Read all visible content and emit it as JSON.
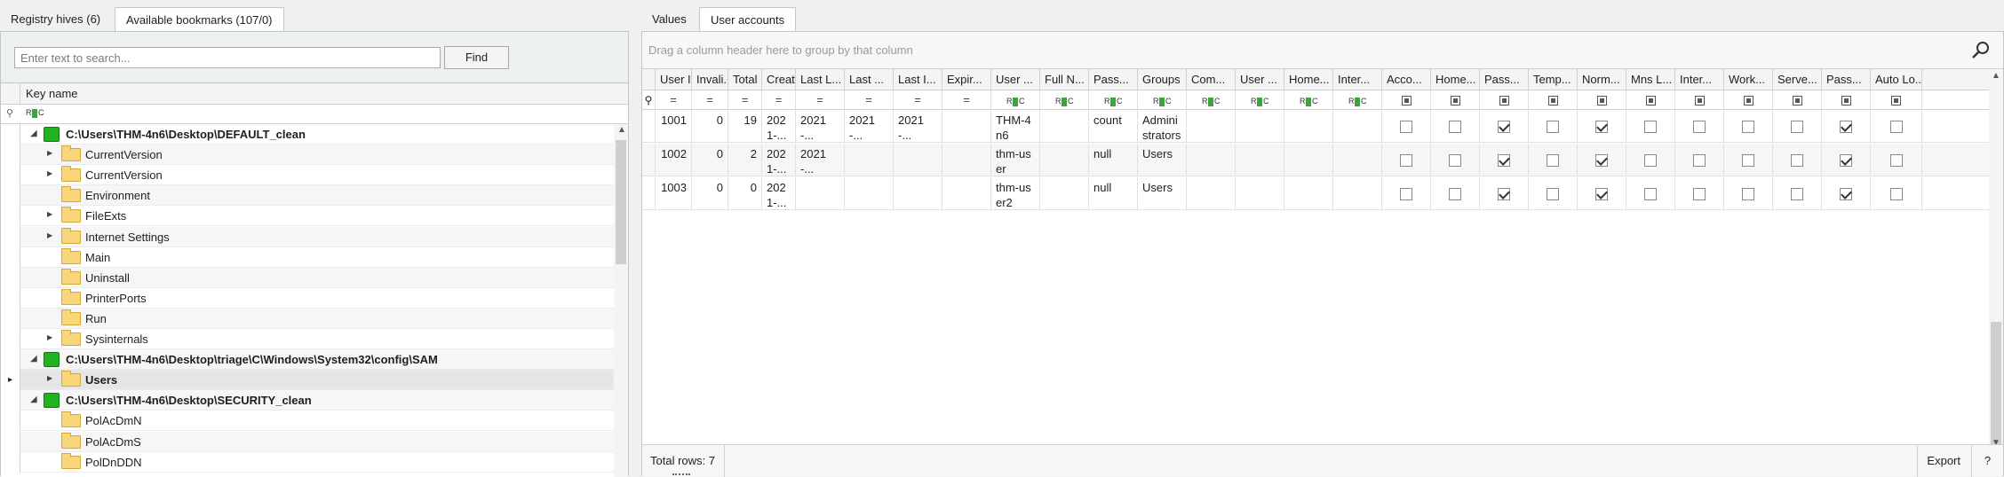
{
  "left": {
    "tabs": [
      "Registry hives (6)",
      "Available bookmarks (107/0)"
    ],
    "search_placeholder": "Enter text to search...",
    "find_label": "Find",
    "column_header": "Key name",
    "tree": [
      {
        "label": "C:\\Users\\THM-4n6\\Desktop\\DEFAULT_clean",
        "kind": "hive",
        "level": 0,
        "expander": "◢"
      },
      {
        "label": "CurrentVersion",
        "kind": "folder",
        "level": 1,
        "expander": "▶"
      },
      {
        "label": "CurrentVersion",
        "kind": "folder",
        "level": 1,
        "expander": "▶"
      },
      {
        "label": "Environment",
        "kind": "folder",
        "level": 1,
        "expander": ""
      },
      {
        "label": "FileExts",
        "kind": "folder",
        "level": 1,
        "expander": "▶"
      },
      {
        "label": "Internet Settings",
        "kind": "folder",
        "level": 1,
        "expander": "▶"
      },
      {
        "label": "Main",
        "kind": "folder",
        "level": 1,
        "expander": ""
      },
      {
        "label": "Uninstall",
        "kind": "folder",
        "level": 1,
        "expander": ""
      },
      {
        "label": "PrinterPorts",
        "kind": "folder",
        "level": 1,
        "expander": ""
      },
      {
        "label": "Run",
        "kind": "folder",
        "level": 1,
        "expander": ""
      },
      {
        "label": "Sysinternals",
        "kind": "folder",
        "level": 1,
        "expander": "▶"
      },
      {
        "label": "C:\\Users\\THM-4n6\\Desktop\\triage\\C\\Windows\\System32\\config\\SAM",
        "kind": "hive",
        "level": 0,
        "expander": "◢"
      },
      {
        "label": "Users",
        "kind": "folder",
        "level": 1,
        "expander": "▶",
        "selected": true
      },
      {
        "label": "C:\\Users\\THM-4n6\\Desktop\\SECURITY_clean",
        "kind": "hive",
        "level": 0,
        "expander": "◢"
      },
      {
        "label": "PolAcDmN",
        "kind": "folder",
        "level": 1,
        "expander": ""
      },
      {
        "label": "PolAcDmS",
        "kind": "folder",
        "level": 1,
        "expander": ""
      },
      {
        "label": "PolDnDDN",
        "kind": "folder",
        "level": 1,
        "expander": ""
      }
    ]
  },
  "right": {
    "tabs": [
      "Values",
      "User accounts"
    ],
    "group_hint": "Drag a column header here to group by that column",
    "columns": [
      {
        "label": "User Id",
        "type": "num"
      },
      {
        "label": "Invali...",
        "type": "num"
      },
      {
        "label": "Total ...",
        "type": "num"
      },
      {
        "label": "Creat...",
        "type": "date"
      },
      {
        "label": "Last L...",
        "type": "date"
      },
      {
        "label": "Last ...",
        "type": "date"
      },
      {
        "label": "Last I...",
        "type": "date"
      },
      {
        "label": "Expir...",
        "type": "date"
      },
      {
        "label": "User ...",
        "type": "text"
      },
      {
        "label": "Full N...",
        "type": "text"
      },
      {
        "label": "Pass...",
        "type": "text"
      },
      {
        "label": "Groups",
        "type": "text"
      },
      {
        "label": "Com...",
        "type": "text"
      },
      {
        "label": "User ...",
        "type": "text"
      },
      {
        "label": "Home...",
        "type": "text"
      },
      {
        "label": "Inter...",
        "type": "text"
      },
      {
        "label": "Acco...",
        "type": "bool"
      },
      {
        "label": "Home...",
        "type": "bool"
      },
      {
        "label": "Pass...",
        "type": "bool"
      },
      {
        "label": "Temp...",
        "type": "bool"
      },
      {
        "label": "Norm...",
        "type": "bool"
      },
      {
        "label": "Mns L...",
        "type": "bool"
      },
      {
        "label": "Inter...",
        "type": "bool"
      },
      {
        "label": "Work...",
        "type": "bool"
      },
      {
        "label": "Serve...",
        "type": "bool"
      },
      {
        "label": "Pass...",
        "type": "bool"
      },
      {
        "label": "Auto Lo...",
        "type": "bool"
      }
    ],
    "filter_eq": "=",
    "filter_rbc": "RBC",
    "rows": [
      [
        "1001",
        "0",
        "19",
        "2021-...",
        "2021-...",
        "2021-...",
        "2021-...",
        "",
        "THM-4n6",
        "",
        "count",
        "Administrators",
        "",
        "",
        "",
        "",
        false,
        false,
        true,
        false,
        true,
        false,
        false,
        false,
        false,
        true,
        false
      ],
      [
        "1002",
        "0",
        "2",
        "2021-...",
        "2021-...",
        "",
        "",
        "",
        "thm-user",
        "",
        "null",
        "Users",
        "",
        "",
        "",
        "",
        false,
        false,
        true,
        false,
        true,
        false,
        false,
        false,
        false,
        true,
        false
      ],
      [
        "1003",
        "0",
        "0",
        "2021-...",
        "",
        "",
        "",
        "",
        "thm-user2",
        "",
        "null",
        "Users",
        "",
        "",
        "",
        "",
        false,
        false,
        true,
        false,
        true,
        false,
        false,
        false,
        false,
        true,
        false
      ]
    ],
    "footer": {
      "total_rows": "Total rows: 7",
      "export_label": "Export",
      "help_label": "?"
    }
  }
}
